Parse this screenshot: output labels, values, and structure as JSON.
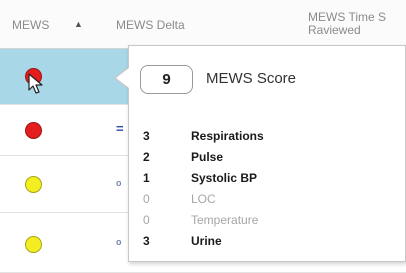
{
  "table": {
    "columns": {
      "mews": "MEWS",
      "mews_delta": "MEWS Delta",
      "time_line1": "MEWS Time S",
      "time_line2": "Raviewed"
    },
    "sort_indicator": "▲",
    "rows": [
      {
        "status": "red",
        "delta": "",
        "selected": true
      },
      {
        "status": "red",
        "delta": "=",
        "selected": false
      },
      {
        "status": "yellow",
        "delta": "o",
        "selected": false
      },
      {
        "status": "yellow",
        "delta": "o",
        "selected": false
      }
    ],
    "colors": {
      "red": "#e41e1e",
      "yellow": "#f3ee22",
      "selected_row": "#a8d8e8"
    }
  },
  "popup": {
    "score": "9",
    "title": "MEWS Score",
    "items": [
      {
        "value": "3",
        "label": "Respirations",
        "active": true
      },
      {
        "value": "2",
        "label": "Pulse",
        "active": true
      },
      {
        "value": "1",
        "label": "Systolic BP",
        "active": true
      },
      {
        "value": "0",
        "label": "LOC",
        "active": false
      },
      {
        "value": "0",
        "label": "Temperature",
        "active": false
      },
      {
        "value": "3",
        "label": "Urine",
        "active": true
      }
    ]
  },
  "cursor_icon": "arrow-pointer-icon"
}
